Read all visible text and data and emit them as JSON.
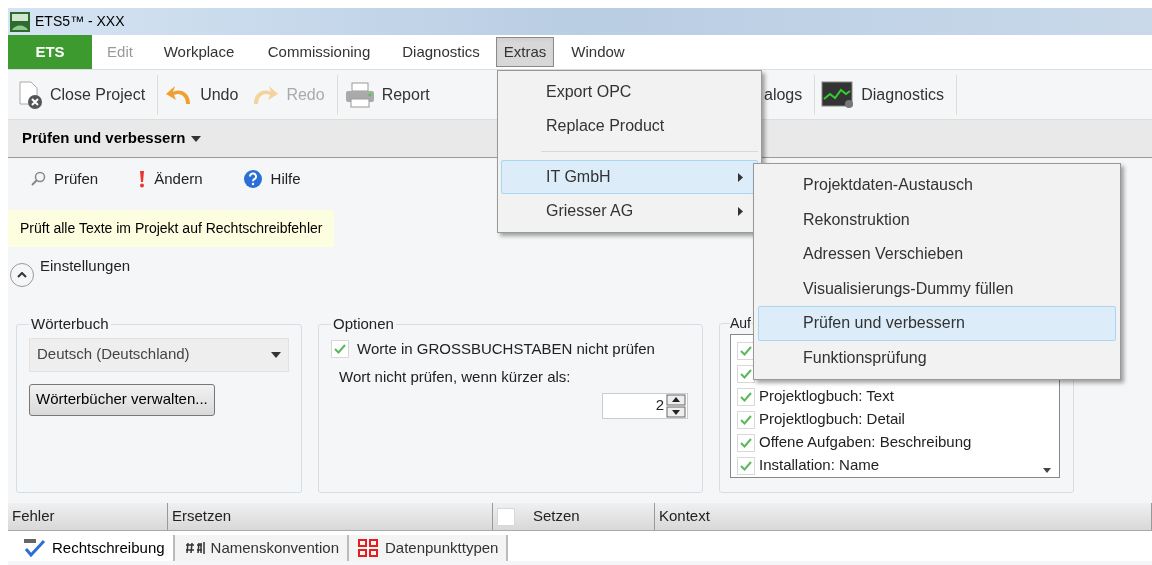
{
  "window": {
    "title": "ETS5™ - XXX"
  },
  "menu_bar": [
    {
      "label": "ETS",
      "kind": "app"
    },
    {
      "label": "Edit",
      "kind": "item",
      "disabled": true,
      "selected": false
    },
    {
      "label": "Workplace",
      "kind": "item",
      "disabled": false,
      "selected": false
    },
    {
      "label": "Commissioning",
      "kind": "item",
      "disabled": false,
      "selected": false
    },
    {
      "label": "Diagnostics",
      "kind": "item",
      "disabled": false,
      "selected": false
    },
    {
      "label": "Extras",
      "kind": "item",
      "disabled": false,
      "selected": true
    },
    {
      "label": "Window",
      "kind": "item",
      "disabled": false,
      "selected": false
    }
  ],
  "toolbar": [
    {
      "label": "Close Project",
      "disabled": false
    },
    {
      "label": "Undo",
      "disabled": false
    },
    {
      "label": "Redo",
      "disabled": true
    },
    {
      "label": "Report",
      "disabled": false
    },
    {
      "label": "alogs",
      "disabled": false
    },
    {
      "label": "Diagnostics",
      "disabled": false
    }
  ],
  "panel": {
    "title": "Prüfen und verbessern",
    "actions": [
      {
        "label": "Prüfen"
      },
      {
        "label": "Ändern"
      },
      {
        "label": "Hilfe"
      }
    ],
    "hint": "Prüft alle Texte im Projekt auf Rechtschreibfehler",
    "settings": {
      "label": "Einstellungen",
      "expanded": true
    },
    "dictionary": {
      "title": "Wörterbuch",
      "value": "Deutsch (Deutschland)",
      "button": "Wörterbücher verwalten..."
    },
    "options": {
      "title": "Optionen",
      "checkbox": {
        "label": "Worte in GROSSBUCHSTABEN nicht prüfen",
        "checked": true
      },
      "min_length_label": "Wort nicht prüfen, wenn kürzer als:",
      "min_length": "2"
    },
    "scope": {
      "title": "Auf",
      "items": [
        {
          "checked": true
        },
        {
          "checked": true
        },
        {
          "label": "Projektlogbuch: Text",
          "checked": true
        },
        {
          "label": "Projektlogbuch: Detail",
          "checked": true
        },
        {
          "label": "Offene Aufgaben: Beschreibung",
          "checked": true
        },
        {
          "label": "Installation: Name",
          "checked": true
        }
      ]
    }
  },
  "table": {
    "columns": [
      {
        "label": "Fehler",
        "kind": "text"
      },
      {
        "label": "Ersetzen",
        "kind": "text"
      },
      {
        "label": "Setzen",
        "kind": "check",
        "checked": false
      },
      {
        "label": "Kontext",
        "kind": "text"
      }
    ]
  },
  "tabs": [
    {
      "label": "Rechtschreibung",
      "selected": true
    },
    {
      "label": "Namenskonvention",
      "selected": false
    },
    {
      "label": "Datenpunkttypen",
      "selected": false
    }
  ],
  "extras_menu": {
    "items": [
      {
        "label": "Export OPC",
        "kind": "item",
        "submenu": false,
        "selected": false
      },
      {
        "label": "Replace Product",
        "kind": "item",
        "submenu": false,
        "selected": false
      },
      {
        "kind": "separator"
      },
      {
        "label": "IT GmbH",
        "kind": "item",
        "submenu": true,
        "selected": true
      },
      {
        "label": "Griesser AG",
        "kind": "item",
        "submenu": true,
        "selected": false
      }
    ]
  },
  "submenu": {
    "items": [
      {
        "label": "Projektdaten-Austausch",
        "selected": false
      },
      {
        "label": "Rekonstruktion",
        "selected": false
      },
      {
        "label": "Adressen Verschieben",
        "selected": false
      },
      {
        "label": "Visualisierungs-Dummy füllen",
        "selected": false
      },
      {
        "label": "Prüfen und verbessern",
        "selected": true
      },
      {
        "label": "Funktionsprüfung",
        "selected": false
      }
    ]
  }
}
